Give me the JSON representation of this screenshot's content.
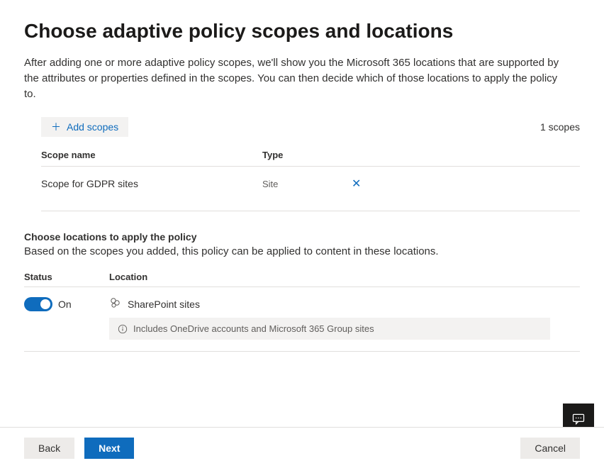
{
  "header": {
    "title": "Choose adaptive policy scopes and locations",
    "intro": "After adding one or more adaptive policy scopes, we'll show you the Microsoft 365 locations that are supported by the attributes or properties defined in the scopes. You can then decide which of those locations to apply the policy to."
  },
  "scopes": {
    "add_button": "Add scopes",
    "count_text": "1 scopes",
    "columns": {
      "name": "Scope name",
      "type": "Type"
    },
    "rows": [
      {
        "name": "Scope for GDPR sites",
        "type": "Site"
      }
    ]
  },
  "locations": {
    "section_label": "Choose locations to apply the policy",
    "section_desc": "Based on the scopes you added, this policy can be applied to content in these locations.",
    "columns": {
      "status": "Status",
      "location": "Location"
    },
    "rows": [
      {
        "status_on": true,
        "status_text": "On",
        "name": "SharePoint sites",
        "notice": "Includes OneDrive accounts and Microsoft 365 Group sites"
      }
    ]
  },
  "footer": {
    "back": "Back",
    "next": "Next",
    "cancel": "Cancel"
  }
}
